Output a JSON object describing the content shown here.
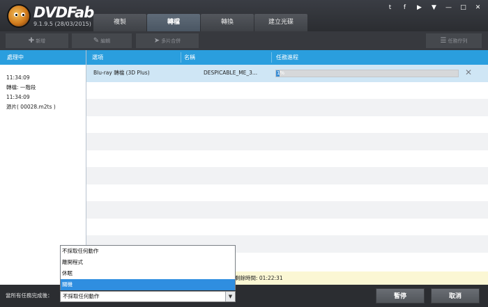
{
  "app": {
    "name": "DVDFab",
    "version": "9.1.9.5 (28/03/2015)"
  },
  "tabs": [
    "複製",
    "轉檔",
    "轉換",
    "建立光碟"
  ],
  "active_tab": 1,
  "window_controls": [
    "t",
    "f",
    "▶",
    "▼",
    "—",
    "□",
    "✕"
  ],
  "toolbar": {
    "add": "新增",
    "edit": "編輯",
    "merge": "多片合併",
    "queue": "任務佇列"
  },
  "left": {
    "header": "處理中",
    "info": [
      "11:34:09",
      "轉檔: 一階段",
      "11:34:09",
      "源片( 00028.m2ts )"
    ]
  },
  "table": {
    "headers": {
      "option": "選項",
      "name": "名稱",
      "progress": "任務進程"
    },
    "row": {
      "option": "Blu-ray 轉檔 (3D Plus)",
      "name": "DESPICABLE_ME_3...",
      "progress_text": "1%",
      "progress": 0.01
    }
  },
  "remaining_time": "剩餘時間: 01:22:31",
  "bottom": {
    "label": "當所有任務完成後：",
    "select_value": "不採取任何動作",
    "options": [
      "不採取任何動作",
      "離開程式",
      "休眠",
      "關機"
    ],
    "highlighted": 3,
    "pause": "暫停",
    "cancel": "取消"
  }
}
